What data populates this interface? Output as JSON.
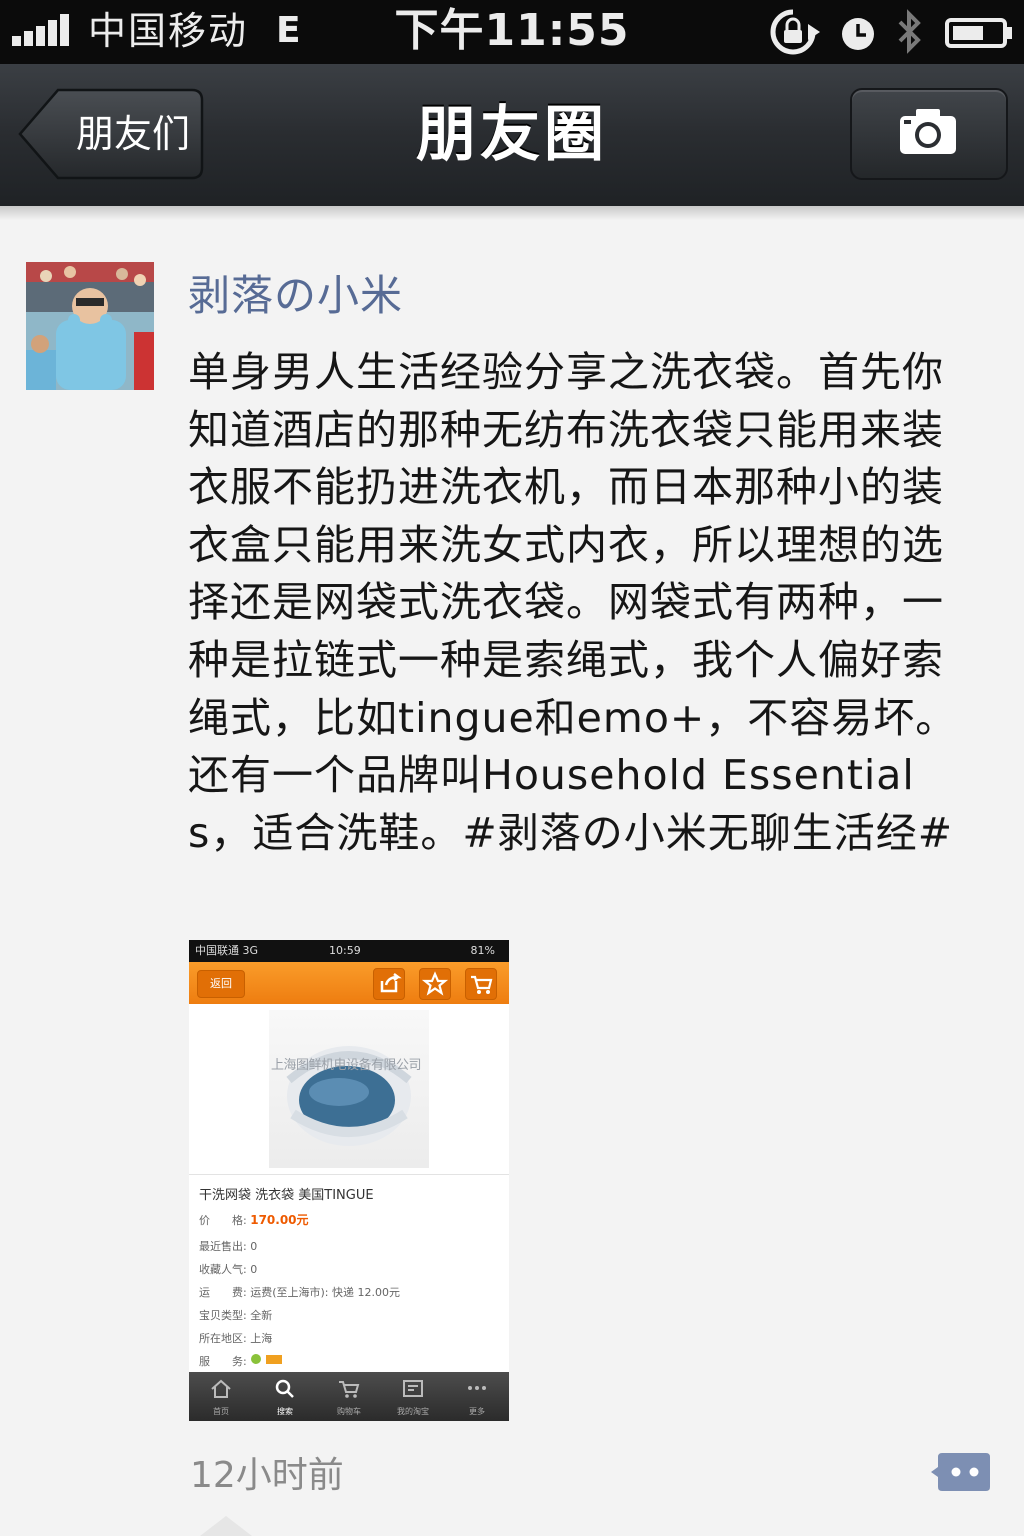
{
  "status_bar": {
    "carrier": "中国移动",
    "network": "E",
    "time": "下午11:55"
  },
  "nav": {
    "back_label": "朋友们",
    "title": "朋友圈"
  },
  "post": {
    "username": "剥落の小米",
    "text": "单身男人生活经验分享之洗衣袋。首先你知道酒店的那种无纺布洗衣袋只能用来装衣服不能扔进洗衣机，而日本那种小的装衣盒只能用来洗女式内衣，所以理想的选择还是网袋式洗衣袋。网袋式有两种，一种是拉链式一种是索绳式，我个人偏好索绳式，比如tingue和emo+，不容易坏。还有一个品牌叫Household Essentials，适合洗鞋。#剥落の小米无聊生活经#",
    "timestamp": "12小时前"
  },
  "attachment": {
    "status_carrier": "中国联通 3G",
    "status_time": "10:59",
    "status_battery": "81%",
    "back_label": "返回",
    "watermark": "上海图鲜机电设备有限公司",
    "product_title": "干洗网袋 洗衣袋 美国TINGUE",
    "rows": [
      {
        "label": "价　　格:",
        "value": "170.00元"
      },
      {
        "label": "最近售出:",
        "value": "0"
      },
      {
        "label": "收藏人气:",
        "value": "0"
      },
      {
        "label": "运　　费:",
        "value": "运费(至上海市): 快递 12.00元"
      },
      {
        "label": "宝贝类型:",
        "value": "全新"
      },
      {
        "label": "所在地区:",
        "value": "上海"
      },
      {
        "label": "服　　务:",
        "value": ""
      }
    ],
    "tabs": [
      "首页",
      "搜索",
      "购物车",
      "我的淘宝",
      "更多"
    ]
  },
  "icons": {
    "camera": "camera-icon",
    "comment": "comment-icon",
    "back": "back-arrow-icon"
  },
  "colors": {
    "username": "#576b95",
    "navbar": "#2a2d31",
    "thumb_accent": "#f28a1a"
  }
}
